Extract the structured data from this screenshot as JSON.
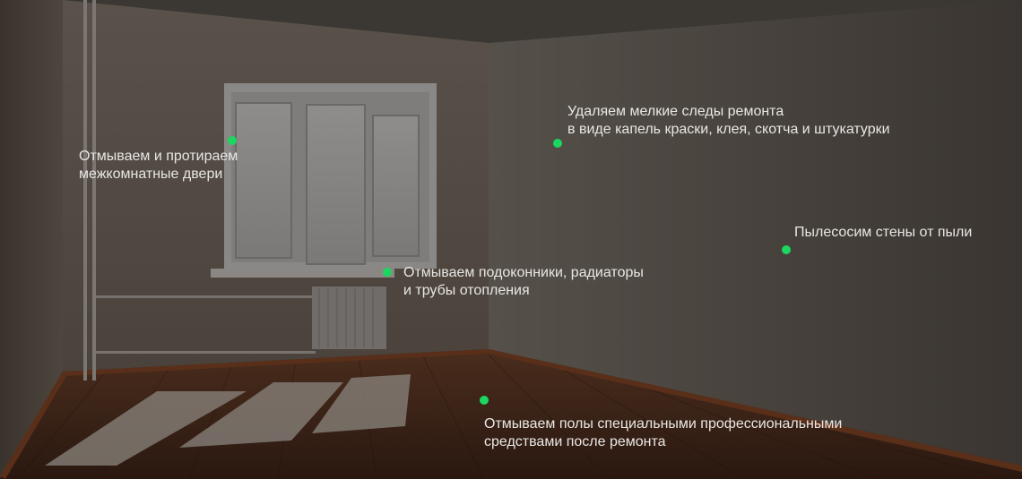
{
  "accent_color": "#1bd760",
  "hotspots": [
    {
      "lines": [
        "Отмываем и протираем",
        "межкомнатные двери"
      ]
    },
    {
      "lines": [
        "Удаляем мелкие следы ремонта",
        "в виде капель краски, клея, скотча и штукатурки"
      ]
    },
    {
      "lines": [
        "Пылесосим стены от пыли"
      ]
    },
    {
      "lines": [
        "Отмываем подоконники, радиаторы",
        "и трубы отопления"
      ]
    },
    {
      "lines": [
        "Отмываем полы специальными профессиональными",
        "средствами после ремонта"
      ]
    }
  ]
}
